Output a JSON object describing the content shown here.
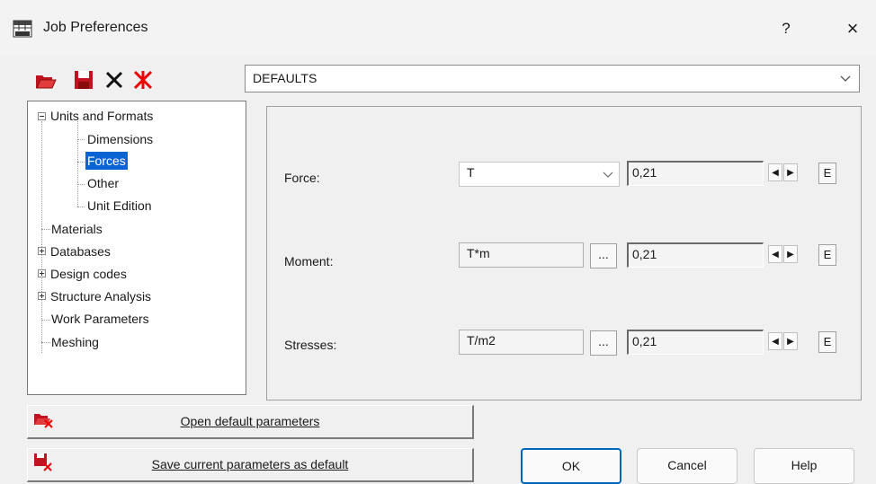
{
  "window": {
    "title": "Job Preferences",
    "help_label": "?",
    "close_label": "×"
  },
  "toolbar": {
    "icons": [
      "open-folder-icon",
      "save-icon",
      "delete-icon",
      "reset-icon"
    ]
  },
  "preset_combo": {
    "value": "DEFAULTS"
  },
  "tree": {
    "items": [
      {
        "label": "Units and Formats",
        "expander": "minus"
      },
      {
        "label": "Dimensions"
      },
      {
        "label": "Forces",
        "selected": true
      },
      {
        "label": "Other"
      },
      {
        "label": "Unit Edition"
      },
      {
        "label": "Materials"
      },
      {
        "label": "Databases",
        "expander": "plus"
      },
      {
        "label": "Design codes",
        "expander": "plus"
      },
      {
        "label": "Structure Analysis",
        "expander": "plus"
      },
      {
        "label": "Work Parameters"
      },
      {
        "label": "Meshing"
      }
    ]
  },
  "settings": {
    "rows": [
      {
        "label": "Force:",
        "unit": "T",
        "value": "0,21",
        "e_label": "E"
      },
      {
        "label": "Moment:",
        "unit": "T*m",
        "ellipsis": "...",
        "value": "0,21",
        "e_label": "E"
      },
      {
        "label": "Stresses:",
        "unit": "T/m2",
        "ellipsis": "...",
        "value": "0,21",
        "e_label": "E"
      }
    ]
  },
  "actions": {
    "open_default": "Open default parameters",
    "save_default": "Save current parameters as default",
    "ok": "OK",
    "cancel": "Cancel",
    "help": "Help"
  },
  "colors": {
    "selection": "#0a64d6",
    "accent": "#0067c0",
    "icon_red": "#c1121f"
  }
}
